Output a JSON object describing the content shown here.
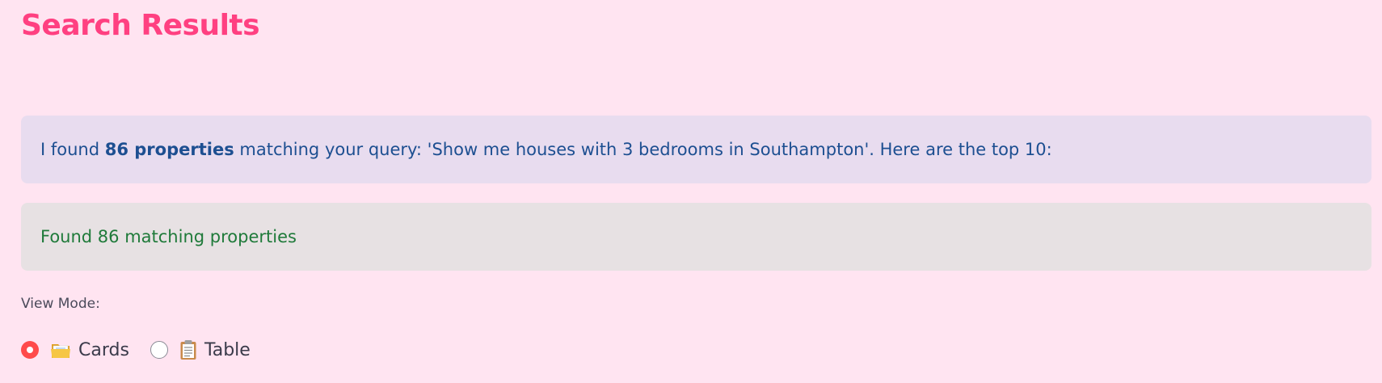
{
  "header": {
    "title": "Search Results"
  },
  "info_alert": {
    "prefix": "I found ",
    "count_text": "86 properties",
    "suffix": " matching your query: 'Show me houses with 3 bedrooms in Southampton'. Here are the top 10:"
  },
  "success_alert": {
    "text": "Found 86 matching properties"
  },
  "view_mode": {
    "label": "View Mode:",
    "options": [
      {
        "icon": "folder-icon",
        "label": "Cards",
        "selected": true
      },
      {
        "icon": "clipboard-icon",
        "label": "Table",
        "selected": false
      }
    ]
  },
  "colors": {
    "background": "#ffe4f1",
    "title": "#ff4081",
    "info_bg": "#e8dcef",
    "info_text": "#1d4f91",
    "success_bg": "#e7e1e3",
    "success_text": "#1f7a3a",
    "radio_selected": "#ff4b4b"
  }
}
